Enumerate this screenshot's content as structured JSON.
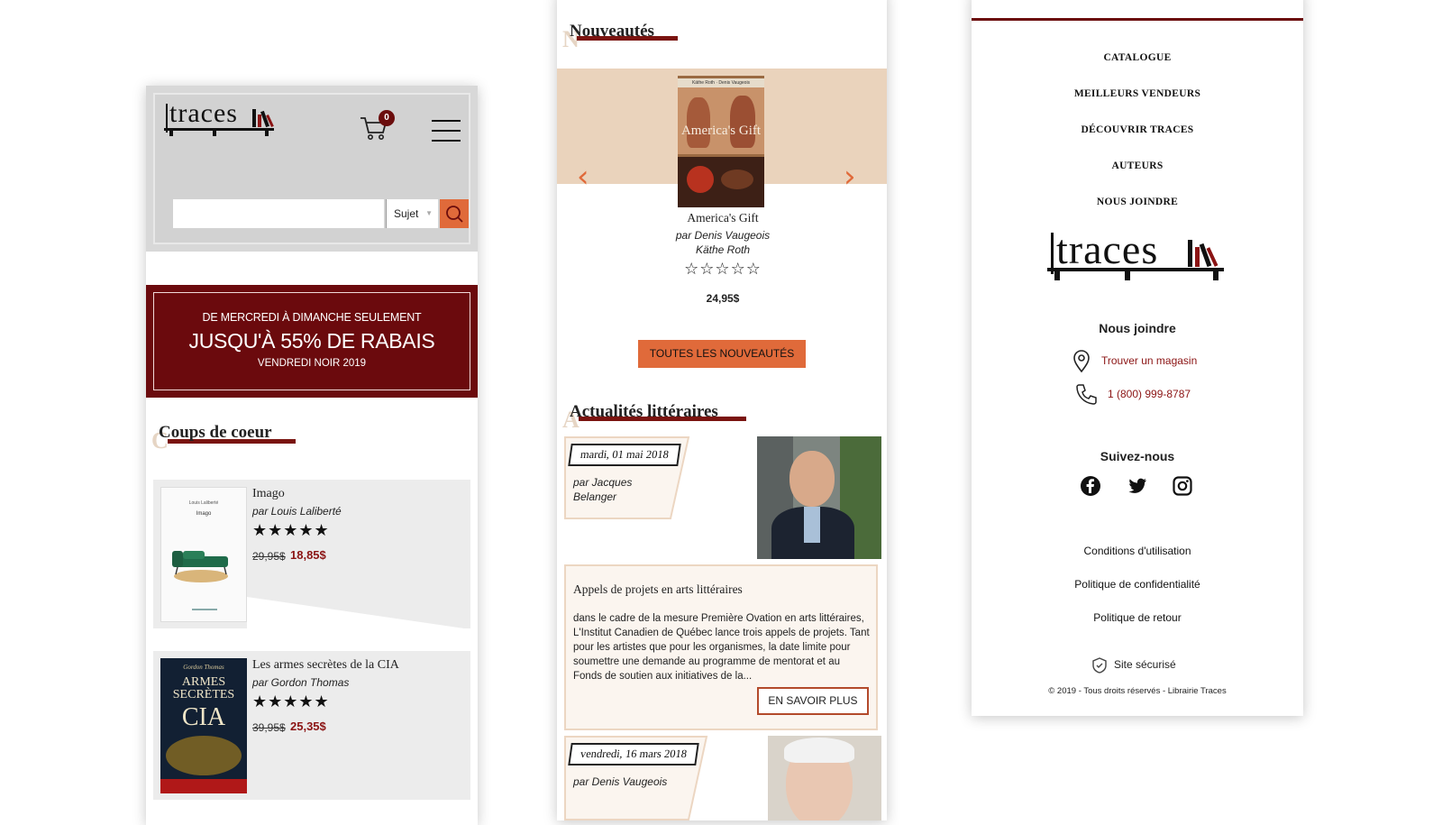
{
  "screen1": {
    "logo_text": "traces",
    "cart_count": "0",
    "search": {
      "placeholder": "",
      "subject_label": "Sujet"
    },
    "promo": {
      "line1": "DE MERCREDI À DIMANCHE SEULEMENT",
      "line2": "JUSQU'À 55% DE RABAIS",
      "line3": "VENDREDI NOIR 2019"
    },
    "section_title": "Coups de coeur",
    "section_ghost": "C",
    "books": [
      {
        "title": "Imago",
        "author": "par Louis Laliberté",
        "rating": 5,
        "stars": "★★★★★",
        "old_price": "29,95$",
        "new_price": "18,85$",
        "cover_author": "Louis Laliberté",
        "cover_title": "Imago"
      },
      {
        "title": "Les armes secrètes de la CIA",
        "author": "par Gordon Thomas",
        "rating": 5,
        "stars": "★★★★★",
        "old_price": "39,95$",
        "new_price": "25,35$",
        "cover_author": "Gordon Thomas",
        "cover_title": "ARMES SECRÈTES",
        "cover_big": "CIA"
      }
    ]
  },
  "screen2": {
    "section_title": "Nouveautés",
    "section_ghost": "N",
    "featured": {
      "cover_authors": "Käthe Roth · Denis Vaugeois",
      "cover_title": "America's Gift",
      "title": "America's Gift",
      "author_line1": "par Denis Vaugeois",
      "author_line2": "Käthe Roth",
      "rating": 0,
      "stars": "☆☆☆☆☆",
      "price": "24,95$"
    },
    "all_button": "TOUTES LES NOUVEAUTÉS",
    "news_title": "Actualités littéraires",
    "news_ghost": "A",
    "news": [
      {
        "date": "mardi, 01 mai 2018",
        "author_line1": "par Jacques",
        "author_line2": "Belanger"
      },
      {
        "date": "vendredi, 16 mars 2018",
        "author_line1": "par Denis Vaugeois"
      }
    ],
    "article": {
      "title": "Appels de projets en arts littéraires",
      "body": "dans le cadre de la mesure Première Ovation en arts littéraires, L'Institut Canadien de Québec lance trois appels de projets. Tant pour les artistes que pour les organismes, la date limite pour soumettre une demande au programme de mentorat et au Fonds de soutien aux initiatives de la...",
      "button": "EN SAVOIR PLUS"
    }
  },
  "screen3": {
    "menu": [
      "CATALOGUE",
      "MEILLEURS VENDEURS",
      "DÉCOUVRIR TRACES",
      "AUTEURS",
      "NOUS JOINDRE"
    ],
    "logo_text": "traces",
    "contact_heading": "Nous joindre",
    "store_link": "Trouver un magasin",
    "phone": "1 (800) 999-8787",
    "follow_heading": "Suivez-nous",
    "social": [
      "facebook-icon",
      "twitter-icon",
      "instagram-icon"
    ],
    "footer_links": [
      "Conditions d'utilisation",
      "Politique de confidentialité",
      "Politique de retour"
    ],
    "secure": "Site sécurisé",
    "copyright": "© 2019 - Tous droits réservés - Librairie Traces"
  },
  "colors": {
    "brand_red": "#6b0d0d",
    "accent_orange": "#e06a3a",
    "beige": "#ead3bc"
  }
}
